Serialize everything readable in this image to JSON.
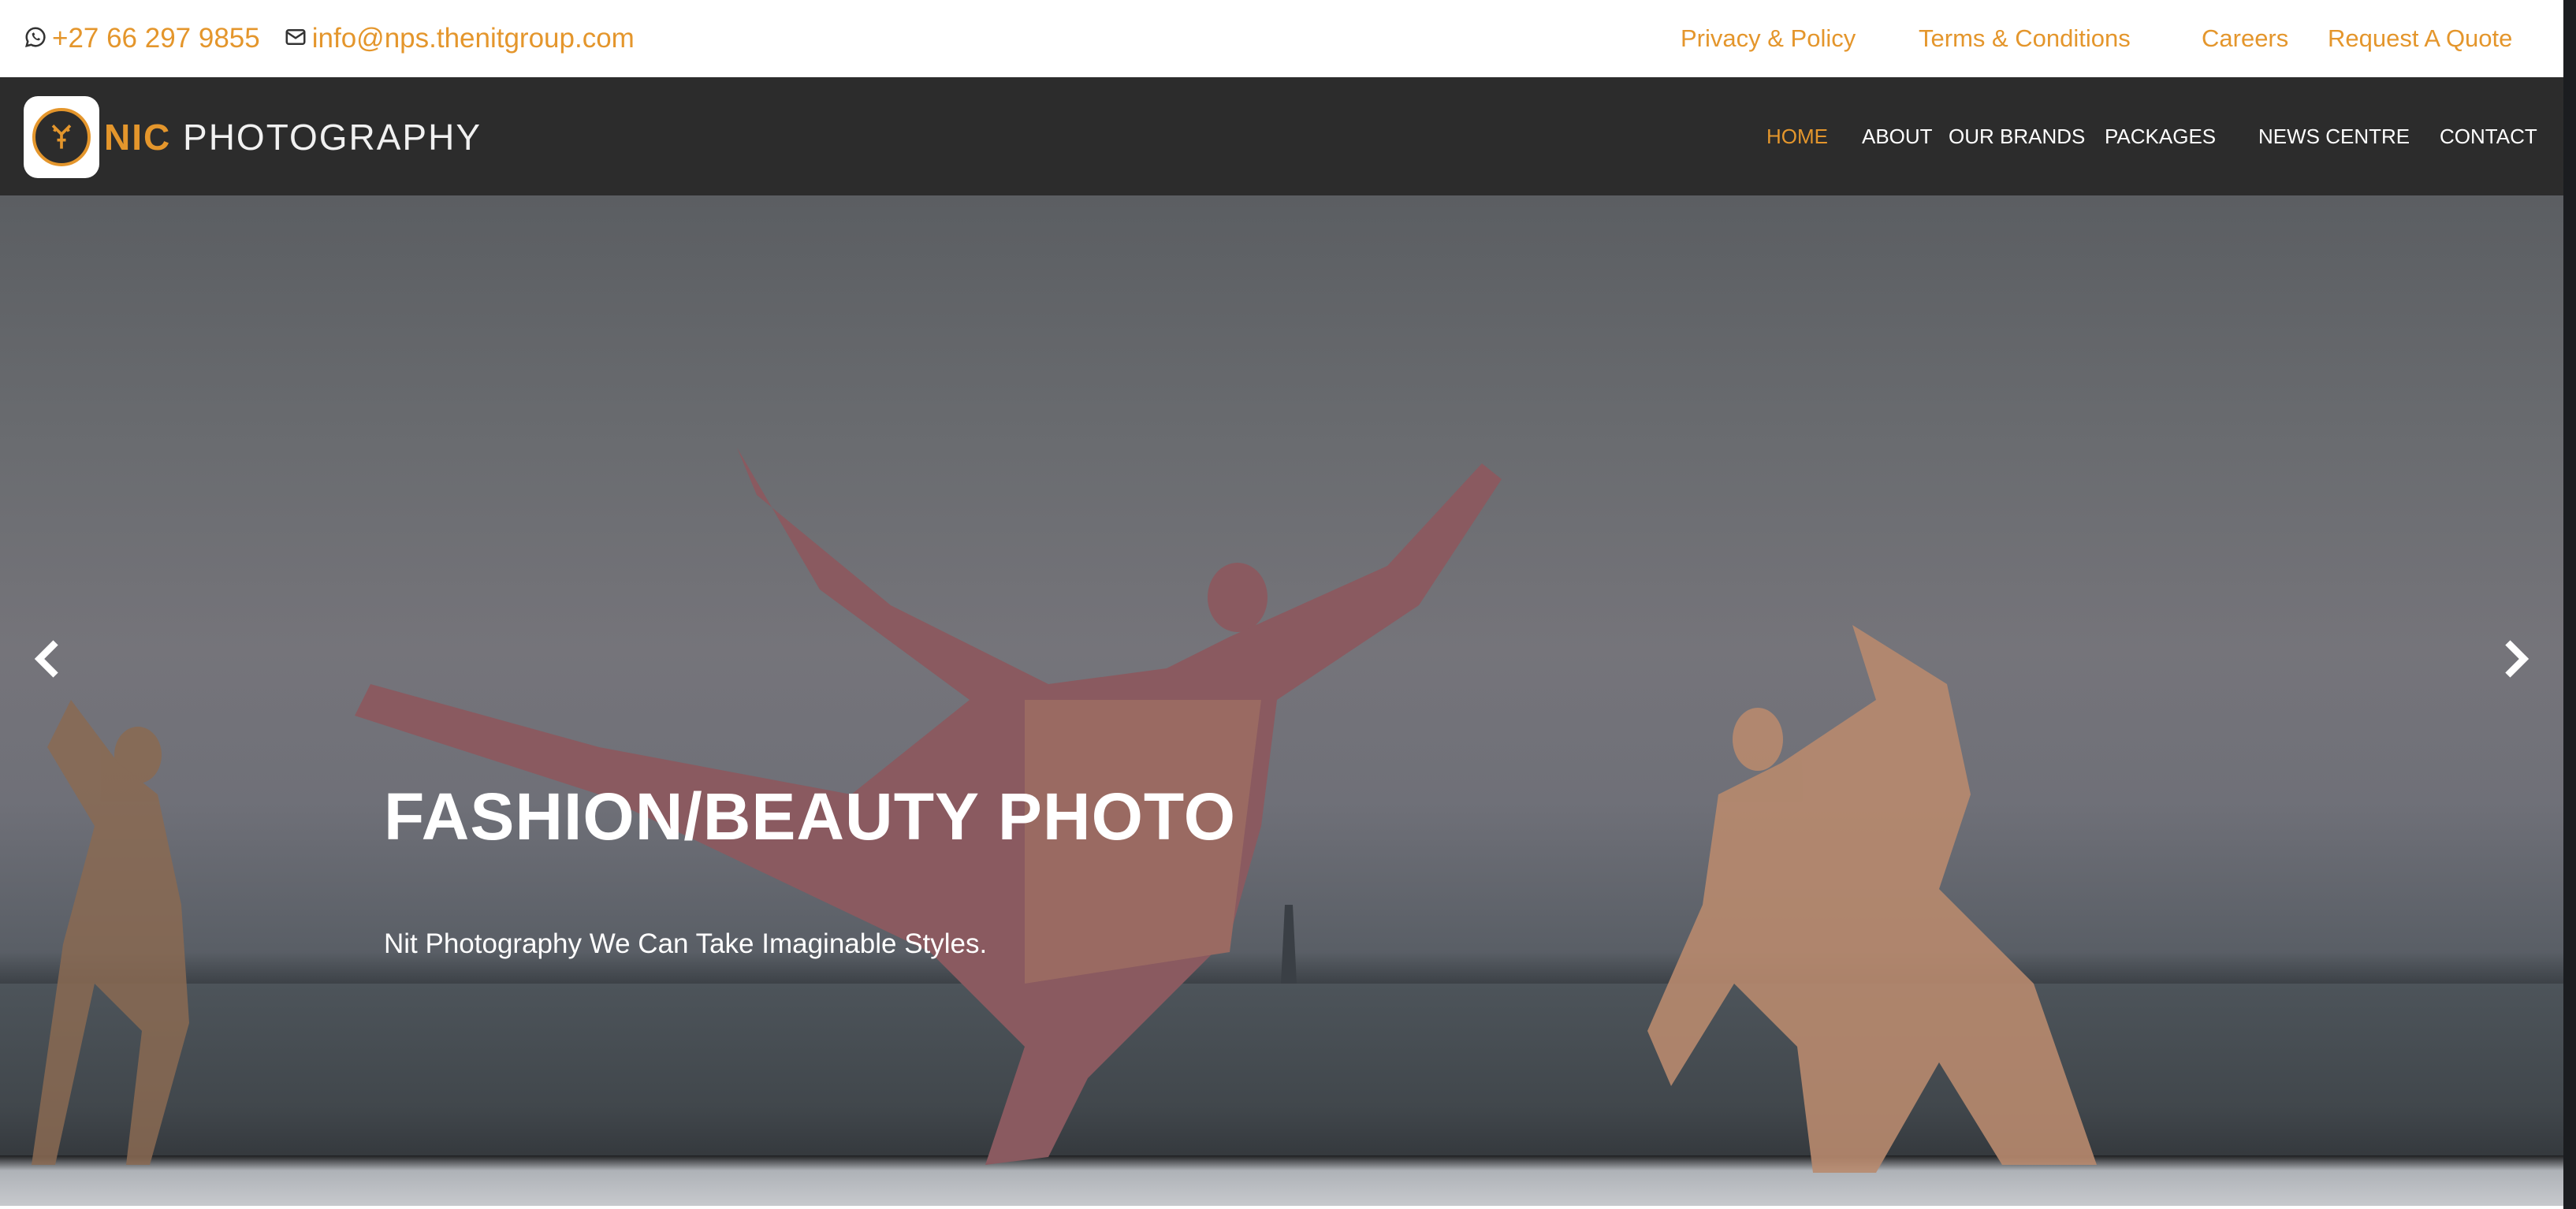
{
  "topbar": {
    "phone": "+27 66 297 9855",
    "email": "info@nps.thenitgroup.com",
    "links": [
      "Privacy & Policy",
      "Terms & Conditions",
      "Careers",
      "Request A Quote"
    ]
  },
  "brand": {
    "name_part1": "NIC",
    "name_part2": "PHOTOGRAPHY"
  },
  "nav": {
    "items": [
      "HOME",
      "ABOUT",
      "OUR BRANDS",
      "PACKAGES",
      "NEWS CENTRE",
      "CONTACT"
    ],
    "active": "HOME"
  },
  "hero": {
    "title": "FASHION/BEAUTY PHOTO",
    "subtitle": "Nit Photography We Can Take Imaginable Styles."
  },
  "icons": {
    "phone": "whatsapp-icon",
    "email": "envelope-icon",
    "prev": "chevron-left-icon",
    "next": "chevron-right-icon"
  },
  "colors": {
    "accent": "#e4962c",
    "navbar": "#2c2c2c",
    "text_light": "#ffffff"
  }
}
